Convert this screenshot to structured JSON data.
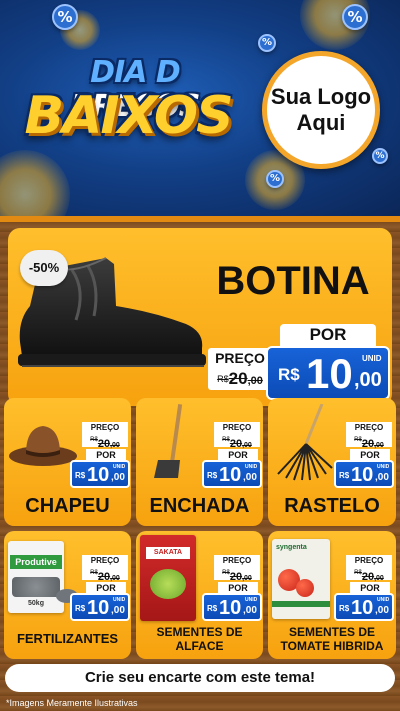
{
  "header": {
    "title_line1": "PREÇOS",
    "title_prefix": "DIA D",
    "title_line2": "BAIXOS",
    "logo_line1": "Sua Logo",
    "logo_line2": "Aqui",
    "badge_symbol": "%"
  },
  "hero": {
    "discount": "-50%",
    "name": "BOTINA",
    "preco_label": "PREÇO",
    "old_currency": "R$",
    "old_int": "20",
    "old_dec": ",00",
    "por_label": "POR",
    "unit_label": "UNID",
    "new_currency": "R$",
    "new_int": "10",
    "new_dec": ",00"
  },
  "products": [
    {
      "name": "CHAPEU",
      "preco_label": "PREÇO",
      "old_currency": "R$",
      "old_int": "20",
      "old_dec": ",00",
      "por_label": "POR",
      "unit_label": "UNID",
      "new_currency": "R$",
      "new_int": "10",
      "new_dec": ",00"
    },
    {
      "name": "ENCHADA",
      "preco_label": "PREÇO",
      "old_currency": "R$",
      "old_int": "20",
      "old_dec": ",00",
      "por_label": "POR",
      "unit_label": "UNID",
      "new_currency": "R$",
      "new_int": "10",
      "new_dec": ",00"
    },
    {
      "name": "RASTELO",
      "preco_label": "PREÇO",
      "old_currency": "R$",
      "old_int": "20",
      "old_dec": ",00",
      "por_label": "POR",
      "unit_label": "UNID",
      "new_currency": "R$",
      "new_int": "10",
      "new_dec": ",00"
    },
    {
      "name": "FERTILIZANTES",
      "preco_label": "PREÇO",
      "old_currency": "R$",
      "old_int": "20",
      "old_dec": ",00",
      "por_label": "POR",
      "unit_label": "UNID",
      "new_currency": "R$",
      "new_int": "10",
      "new_dec": ",00",
      "pack_brand": "Produtive",
      "pack_weight": "50kg"
    },
    {
      "name_line1": "SEMENTES DE",
      "name_line2": "ALFACE",
      "preco_label": "PREÇO",
      "old_currency": "R$",
      "old_int": "20",
      "old_dec": ",00",
      "por_label": "POR",
      "unit_label": "UNID",
      "new_currency": "R$",
      "new_int": "10",
      "new_dec": ",00",
      "pack_brand": "SAKATA"
    },
    {
      "name_line1": "SEMENTES DE",
      "name_line2": "TOMATE HIBRIDA",
      "preco_label": "PREÇO",
      "old_currency": "R$",
      "old_int": "20",
      "old_dec": ",00",
      "por_label": "POR",
      "unit_label": "UNID",
      "new_currency": "R$",
      "new_int": "10",
      "new_dec": ",00",
      "pack_brand": "syngenta"
    }
  ],
  "footer": {
    "cta": "Crie seu encarte com este tema!",
    "note": "*Imagens Meramente Ilustrativas"
  },
  "colors": {
    "header_blue": "#123f86",
    "title_yellow": "#ffcf2e",
    "card_orange": "#f7a20f",
    "price_blue": "#0c4bb6",
    "wood": "#7a4a1f"
  }
}
